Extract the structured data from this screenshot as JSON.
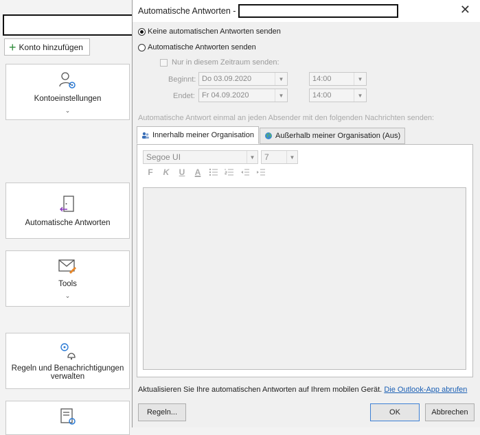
{
  "background": {
    "add_account_label": "Konto hinzufügen",
    "tiles": [
      {
        "label": "Kontoeinstellungen",
        "chevron": "⌄",
        "icon": "account-settings-icon"
      },
      {
        "label": "Automatische Antworten",
        "icon": "door-exit-icon"
      },
      {
        "label": "Tools",
        "chevron": "⌄",
        "icon": "mail-tools-icon"
      },
      {
        "label": "Regeln und Benachrichtigungen verwalten",
        "icon": "rules-bell-icon"
      },
      {
        "label": "",
        "icon": "mailbox-settings-icon"
      }
    ]
  },
  "dialog": {
    "title": "Automatische Antworten -",
    "close_glyph": "✕",
    "radio_no_auto": "Keine automatischen Antworten senden",
    "radio_send_auto": "Automatische Antworten senden",
    "checkbox_period": "Nur in diesem Zeitraum senden:",
    "start_label": "Beginnt:",
    "start_date": "Do 03.09.2020",
    "start_time": "14:00",
    "end_label": "Endet:",
    "end_date": "Fr 04.09.2020",
    "end_time": "14:00",
    "note": "Automatische Antwort einmal an jeden Absender mit den folgenden Nachrichten senden:",
    "tabs": [
      {
        "label": "Innerhalb meiner Organisation",
        "active": true
      },
      {
        "label": "Außerhalb meiner Organisation (Aus)",
        "active": false
      }
    ],
    "font_name": "Segoe UI",
    "font_size": "7",
    "format_buttons": [
      "F",
      "K",
      "U",
      "A"
    ],
    "footer_text": "Aktualisieren Sie Ihre automatischen Antworten auf Ihrem mobilen Gerät.",
    "footer_link": "Die Outlook-App abrufen",
    "rules_button": "Regeln...",
    "ok_button": "OK",
    "cancel_button": "Abbrechen",
    "selected_radio": "no_auto"
  },
  "colors": {
    "accent": "#1a5fb4",
    "add_plus": "#2e8b3a",
    "icon_purple": "#8b3bbf",
    "icon_blue": "#2a7ad5",
    "icon_orange": "#e8872a"
  }
}
